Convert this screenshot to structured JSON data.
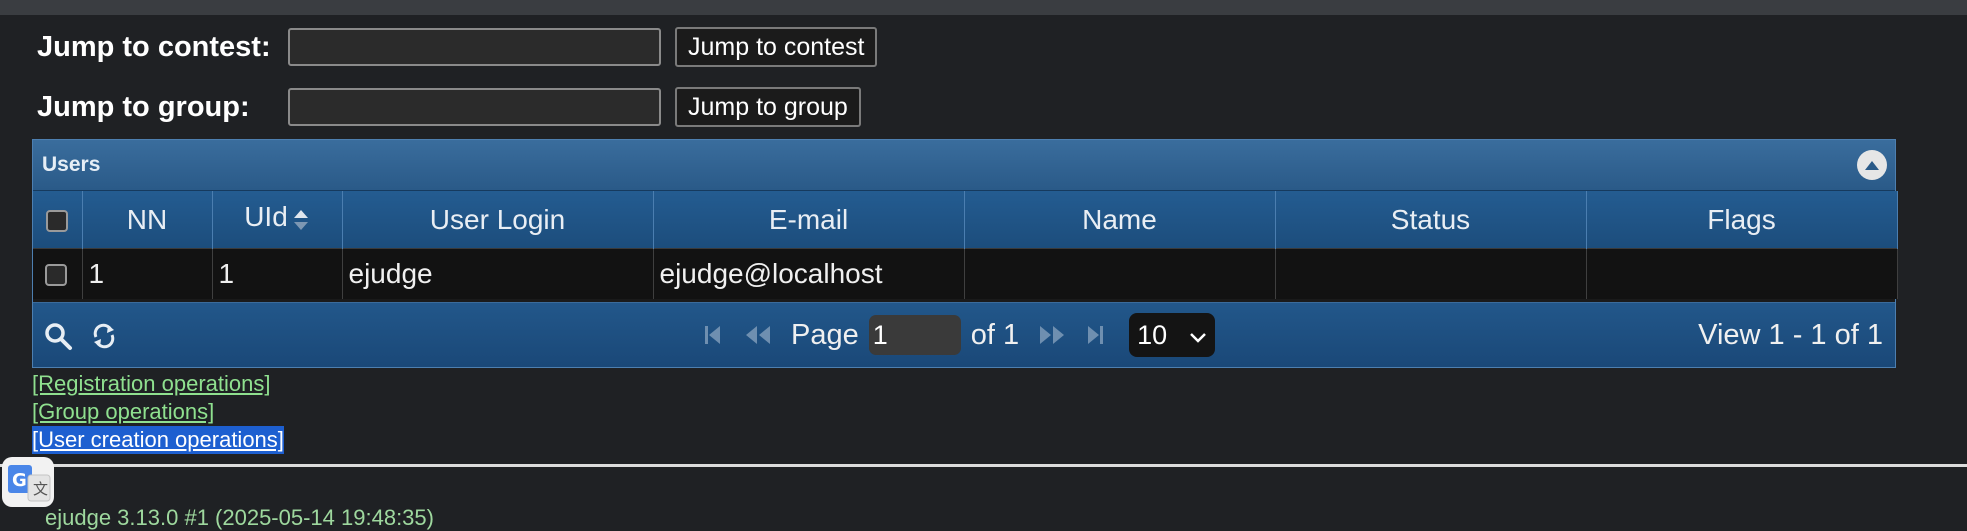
{
  "jump_contest": {
    "label": "Jump to contest:",
    "value": "",
    "button": "Jump to contest"
  },
  "jump_group": {
    "label": "Jump to group:",
    "value": "",
    "button": "Jump to group"
  },
  "grid": {
    "caption": "Users",
    "columns": [
      "NN",
      "UId",
      "User Login",
      "E-mail",
      "Name",
      "Status",
      "Flags"
    ],
    "sorted_column": "UId",
    "rows": [
      {
        "nn": "1",
        "uid": "1",
        "login": "ejudge",
        "email": "ejudge@localhost",
        "name": "",
        "status": "",
        "flags": ""
      }
    ],
    "pager": {
      "page_label": "Page",
      "page_value": "1",
      "of_label": "of 1",
      "rows_per_page": "10",
      "view_text": "View 1 - 1 of 1"
    }
  },
  "links": [
    "[Registration operations]",
    "[Group operations]",
    "[User creation operations]"
  ],
  "selected_link": "[User creation operations]",
  "footer": "ejudge 3.13.0 #1 (2025-05-14 19:48:35)",
  "icons": [
    "collapse-icon",
    "sort-icon",
    "search-icon",
    "refresh-icon",
    "first-page-icon",
    "prev-page-icon",
    "next-page-icon",
    "last-page-icon",
    "chevron-down-icon",
    "translate-icon"
  ],
  "colors": {
    "header_blue": "#245c91",
    "link_green": "#8fe08f",
    "selection_blue": "#1d5fd0"
  }
}
